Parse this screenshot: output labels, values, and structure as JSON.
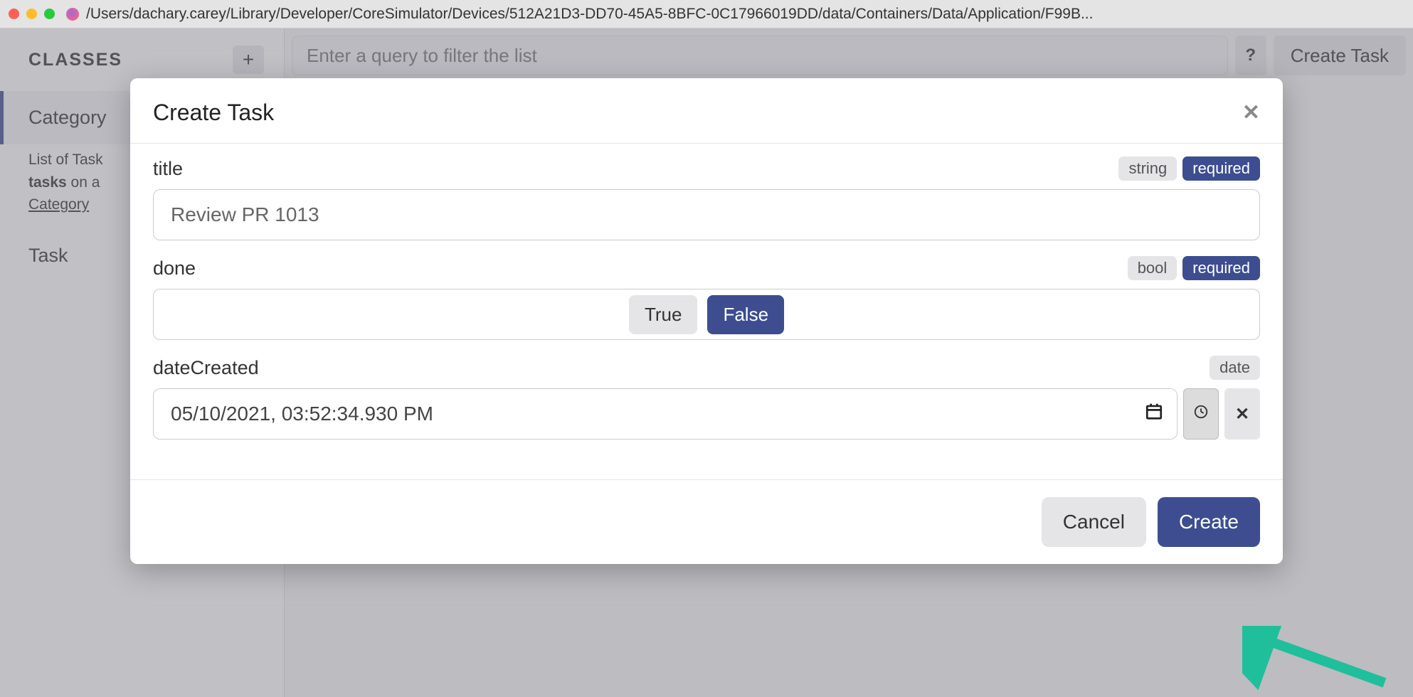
{
  "titlebar": {
    "path": "/Users/dachary.carey/Library/Developer/CoreSimulator/Devices/512A21D3-DD70-45A5-8BFC-0C17966019DD/data/Containers/Data/Application/F99B..."
  },
  "sidebar": {
    "header": "CLASSES",
    "addTooltip": "+",
    "items": [
      {
        "name": "Category",
        "active": true
      },
      {
        "name": "Task",
        "active": false
      }
    ],
    "description": {
      "line1_prefix": "List of Task ",
      "bold": "tasks",
      "line2_mid": " on a ",
      "link": "Category"
    }
  },
  "toolbar": {
    "queryPlaceholder": "Enter a query to filter the list",
    "helpLabel": "?",
    "createLabel": "Create Task"
  },
  "modal": {
    "title": "Create Task",
    "fields": {
      "title": {
        "label": "title",
        "type": "string",
        "required": "required",
        "value": "Review PR 1013"
      },
      "done": {
        "label": "done",
        "type": "bool",
        "required": "required",
        "trueLabel": "True",
        "falseLabel": "False",
        "selected": "false"
      },
      "dateCreated": {
        "label": "dateCreated",
        "type": "date",
        "value": "05/10/2021, 03:52:34.930 PM"
      }
    },
    "cancelLabel": "Cancel",
    "createLabel": "Create"
  }
}
